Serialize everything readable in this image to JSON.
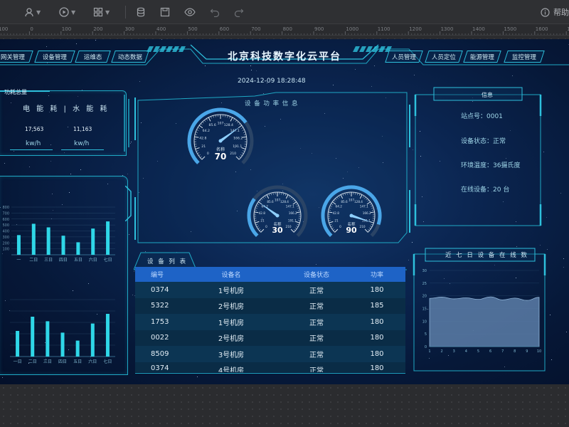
{
  "toolbar": {
    "help_label": "帮助",
    "icons": [
      "user-icon",
      "play-icon",
      "grid-icon",
      "database-icon",
      "save-icon",
      "eye-icon",
      "undo-icon",
      "redo-icon",
      "info-icon"
    ]
  },
  "ruler": {
    "ticks": [
      "100",
      "0",
      "100",
      "200",
      "300",
      "400",
      "500",
      "600",
      "700",
      "800",
      "900",
      "1000",
      "1100",
      "1200",
      "1300",
      "1400",
      "1500",
      "1600",
      "1700",
      "1800"
    ]
  },
  "dashboard": {
    "title": "北京科技数字化云平台",
    "datetime": "2024-12-09 18:28:48",
    "nav_left": [
      "网关管理",
      "设备管理",
      "运维态",
      "动态数据"
    ],
    "nav_right": [
      "人员管理",
      "人员定位",
      "能源管理",
      "监控管理"
    ]
  },
  "energy": {
    "panel_title": "功耗总量",
    "header": "电 能 耗 | 水 能 耗",
    "electric": {
      "value": "17,563",
      "unit": "kw/h"
    },
    "water": {
      "value": "11,163",
      "unit": "kw/h"
    }
  },
  "gauges": {
    "panel_title": "设 备 功 率 信 息",
    "items": [
      {
        "name": "名称",
        "value": "70",
        "fraction": 0.7,
        "ticks": [
          "0",
          "21",
          "42.8",
          "64.2",
          "85.6",
          "107",
          "128.4",
          "147.1",
          "166.2",
          "191.1",
          "210"
        ]
      },
      {
        "name": "名称",
        "value": "30",
        "fraction": 0.3,
        "ticks": [
          "0",
          "21",
          "42.8",
          "64.2",
          "85.6",
          "107",
          "128.4",
          "147.1",
          "166.2",
          "191.1",
          "210"
        ]
      },
      {
        "name": "名称",
        "value": "90",
        "fraction": 0.9,
        "ticks": [
          "0",
          "21",
          "42.8",
          "64.2",
          "85.6",
          "107",
          "128.4",
          "147.1",
          "166.2",
          "191.1",
          "210"
        ]
      }
    ]
  },
  "info": {
    "panel_title": "信息",
    "site": "站点号：0001",
    "status": "设备状态：正常",
    "temperature": "环境温度：36摄氏度",
    "online": "在线设备：20 台"
  },
  "device_list": {
    "panel_title": "设 备 列 表",
    "columns": [
      "编号",
      "设备名",
      "设备状态",
      "功率"
    ],
    "rows": [
      [
        "0374",
        "1号机房",
        "正常",
        "180"
      ],
      [
        "5322",
        "2号机房",
        "正常",
        "185"
      ],
      [
        "1753",
        "1号机房",
        "正常",
        "180"
      ],
      [
        "0022",
        "2号机房",
        "正常",
        "180"
      ],
      [
        "8509",
        "3号机房",
        "正常",
        "180"
      ],
      [
        "0374",
        "4号机房",
        "正常",
        "180"
      ]
    ]
  },
  "chart_data": [
    {
      "type": "bar",
      "title": "",
      "categories": [
        "一",
        "二日",
        "三日",
        "四日",
        "五日",
        "六日",
        "七日"
      ],
      "values": [
        330,
        520,
        460,
        320,
        210,
        440,
        560
      ],
      "ylim": [
        0,
        800
      ],
      "yticks": [
        "",
        "100",
        "200",
        "300",
        "400",
        "500",
        "600",
        "700",
        "800"
      ],
      "color": "#2fd7e8"
    },
    {
      "type": "bar",
      "title": "",
      "categories": [
        "一日",
        "二日",
        "三日",
        "四日",
        "五日",
        "六日",
        "七日"
      ],
      "values": [
        45,
        70,
        62,
        42,
        28,
        58,
        75
      ],
      "ylim": [
        0,
        100
      ],
      "color": "#2fd7e8"
    },
    {
      "type": "area",
      "title": "近 七 日 设 备 在 线 数",
      "x": [
        "1",
        "2",
        "3",
        "4",
        "5",
        "6",
        "7",
        "8",
        "9",
        "10"
      ],
      "values": [
        19,
        19.5,
        18.8,
        19.2,
        18.6,
        19.6,
        18.4,
        19.1,
        18.2,
        19.4
      ],
      "ylim": [
        0,
        30
      ],
      "yticks": [
        "0",
        "5",
        "10",
        "15",
        "20",
        "25",
        "30"
      ],
      "color": "#5c7ea8"
    }
  ]
}
